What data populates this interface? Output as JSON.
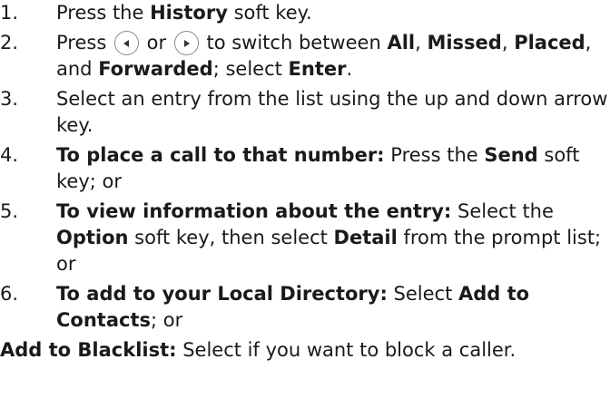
{
  "steps": [
    {
      "number": "1.",
      "t1": "Press the ",
      "b1": "History",
      "t2": " soft key."
    },
    {
      "number": "2.",
      "t1": "Press ",
      "left_icon": "left-arrow-key-icon",
      "t2": " or ",
      "right_icon": "right-arrow-key-icon",
      "t3": " to switch between ",
      "b1": "All",
      "t4": ", ",
      "b2": "Missed",
      "t5": ", ",
      "b3": "Placed",
      "t6": ", and ",
      "b4": "Forwarded",
      "t7": "; select ",
      "b5": "Enter",
      "t8": "."
    },
    {
      "number": "3.",
      "t1": "Select an entry from the list using the up and down arrow key."
    },
    {
      "number": "4.",
      "b1": "To place a call to that number:",
      "t1": "  Press the ",
      "b2": "Send",
      "t2": " soft key; or"
    },
    {
      "number": "5.",
      "b1": "To view information about the entry:",
      "t1": "  Select the ",
      "b2": "Option",
      "t2": " soft key, then select ",
      "b3": "Detail",
      "t3": " from the prompt list; or"
    },
    {
      "number": "6.",
      "b1": "To add to your Local Directory:",
      "t1": "  Select ",
      "b2": "Add to Contacts",
      "t2": "; or"
    }
  ],
  "footer": {
    "b1": "Add to Blacklist:",
    "t1": " Select if you want to block a caller."
  }
}
